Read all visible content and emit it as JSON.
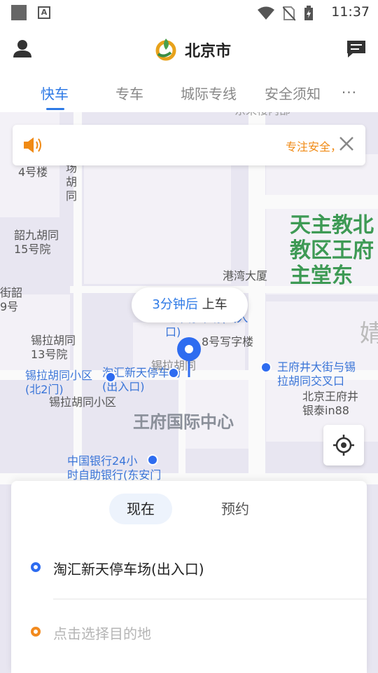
{
  "status": {
    "time": "11:37",
    "notification_glyph": "A"
  },
  "header": {
    "city": "北京市"
  },
  "tabs": [
    {
      "label": "快车"
    },
    {
      "label": "专车"
    },
    {
      "label": "城际专线"
    },
    {
      "label": "安全须知"
    }
  ],
  "tabs_more": "···",
  "notice": {
    "text": "专注安全，"
  },
  "pickup": {
    "eta": "3分钟后",
    "action": "上车"
  },
  "map_labels": {
    "top_partial": "东来楼内部",
    "lou4": "4号楼",
    "hutong_side": "场\n胡\n同",
    "shaojiu": "韶九胡同\n15号院",
    "jieshao": "街韶\n9号",
    "gangwan": "港湾大厦",
    "xila13": "锡拉胡同\n13号院",
    "parking_under": "地下停车场(出入\n口)",
    "building8": "8号写字楼",
    "xila_north2": "锡拉胡同小区\n(北2门)",
    "taohui_entrance": "淘汇新天停车场\n(出入口)",
    "xila_xiaoqu": "锡拉胡同小区",
    "xila_hutong_road": "锡拉胡同",
    "wangfu_intersection": "王府井大街与锡\n拉胡同交叉口",
    "yintai": "北京王府井\n银泰in88",
    "church": "天主教北\n教区王府\n主堂东",
    "wangfu_center": "王府国际中心",
    "boc": "中国银行24小\n时自助银行(东安门",
    "big_partial": "婧"
  },
  "panel": {
    "mode_now": "现在",
    "mode_book": "预约",
    "start": "淘汇新天停车场(出入口)",
    "destination_placeholder": "点击选择目的地"
  },
  "colors": {
    "accent": "#2e7ae6",
    "notice": "#f08a14",
    "destination_dot": "#f28a1e"
  }
}
